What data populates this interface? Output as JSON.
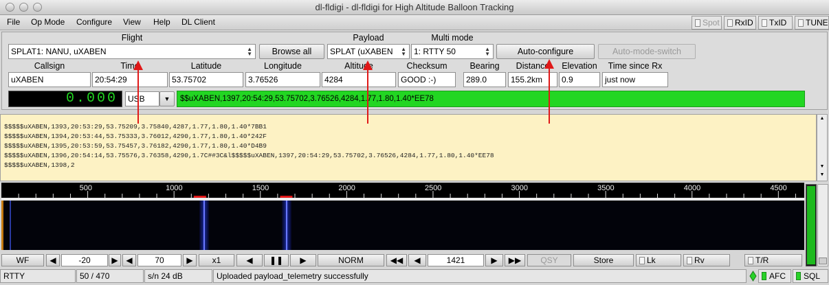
{
  "window": {
    "title": "dl-fldigi - dl-fldigi for High Altitude Balloon Tracking"
  },
  "menu": {
    "items": [
      "File",
      "Op Mode",
      "Configure",
      "View",
      "Help",
      "DL Client"
    ],
    "toggles": [
      "Spot",
      "RxID",
      "TxID",
      "TUNE"
    ]
  },
  "flight": {
    "label": "Flight",
    "value": "SPLAT1: NANU, uXABEN",
    "browse": "Browse all"
  },
  "payload": {
    "label": "Payload",
    "value": "SPLAT (uXABEN"
  },
  "multimode": {
    "label": "Multi mode",
    "value": "1: RTTY 50",
    "autoconfig": "Auto-configure",
    "automode": "Auto-mode-switch"
  },
  "telemetry": {
    "labels": [
      "Callsign",
      "Time",
      "Latitude",
      "Longitude",
      "Altitude",
      "Checksum",
      "Bearing",
      "Distance",
      "Elevation",
      "Time since Rx"
    ],
    "values": [
      "uXABEN",
      "20:54:29",
      "53.75702",
      "3.76526",
      "4284",
      "GOOD :-)",
      "289.0",
      "155.2km",
      "0.9",
      "just now"
    ]
  },
  "freq": {
    "display": "0.000",
    "sideband": "USB"
  },
  "last_sentence": "$$uXABEN,1397,20:54:29,53.75702,3.76526,4284,1.77,1.80,1.40*EE78",
  "rx_lines": [
    "$$$$$uXABEN,1393,20:53:29,53.75209,3.75840,4287,1.77,1.80,1.40*7BB1",
    "$$$$$uXABEN,1394,20:53:44,53.75333,3.76012,4290,1.77,1.80,1.40*242F",
    "$$$$$uXABEN,1395,20:53:59,53.75457,3.76182,4290,1.77,1.80,1.40*D4B9",
    "$$$$$uXABEN,1396,20:54:14,53.75576,3.76358,4290,1.7C##3C&l$$$$$uXABEN,1397,20:54:29,53.75702,3.76526,4284,1.77,1.80,1.40*EE78",
    "$$$$$uXABEN,1398,2"
  ],
  "scale": {
    "ticks": [
      "500",
      "1000",
      "1500",
      "2000",
      "2500",
      "3000",
      "3500",
      "4000",
      "4500"
    ],
    "max": 4650,
    "markers": [
      1150,
      1650
    ]
  },
  "controls": {
    "wf": "WF",
    "ref": "-20",
    "range": "70",
    "x1": "x1",
    "norm": "NORM",
    "freq": "1421",
    "qsy": "QSY",
    "store": "Store",
    "lk": "Lk",
    "rv": "Rv",
    "tr": "T/R"
  },
  "status": {
    "mode": "RTTY",
    "bw": "50  / 470",
    "sn": "s/n  24 dB",
    "message": "Uploaded payload_telemetry successfully",
    "afc": "AFC",
    "sql": "SQL"
  },
  "colors": {
    "rx_bg": "#fdf2c4",
    "green": "#22d622",
    "arrow": "#e01818"
  }
}
